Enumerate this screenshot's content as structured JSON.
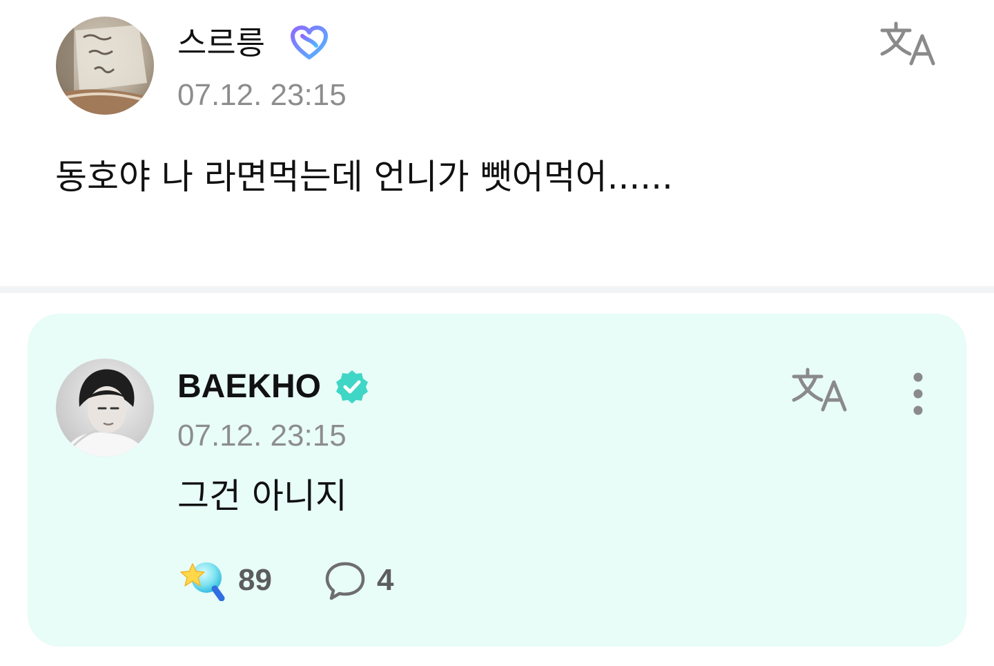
{
  "post": {
    "author": "스르릉",
    "timestamp": "07.12. 23:15",
    "body": "동호야 나 라면먹는데 언니가 뺏어먹어......",
    "icons": {
      "badge": "fan-membership-badge-icon",
      "translate": "translate-icon"
    }
  },
  "reply": {
    "author": "BAEKHO",
    "timestamp": "07.12. 23:15",
    "body": "그건 아니지",
    "reaction_count": "89",
    "comment_count": "4",
    "icons": {
      "badge": "verified-badge-icon",
      "translate": "translate-icon",
      "more": "more-vertical-icon",
      "reaction": "star-lightstick-icon",
      "comment": "comment-bubble-icon"
    }
  },
  "colors": {
    "card_background": "#e8fcf8",
    "verified_badge": "#3fd6c6",
    "timestamp_text": "#8d8d8d",
    "divider": "#f2f3f4"
  }
}
